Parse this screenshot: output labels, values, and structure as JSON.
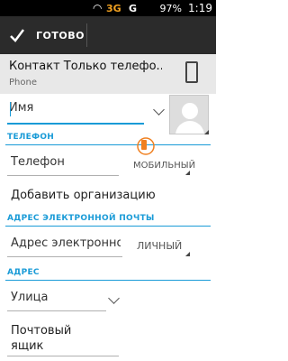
{
  "status_bar": {
    "network_1": "3G",
    "network_2": "G",
    "battery": "97%",
    "time": "1:19"
  },
  "action_bar": {
    "done_label": "ГОТОВО"
  },
  "account": {
    "title": "Контакт Только телефо...",
    "subtitle": "Phone"
  },
  "name": {
    "placeholder": "Имя"
  },
  "phone_section": {
    "header": "ТЕЛЕФОН",
    "field_placeholder": "Телефон",
    "type_label": "МОБИЛЬНЫЙ"
  },
  "add_org_label": "Добавить организацию",
  "email_section": {
    "header": "АДРЕС ЭЛЕКТРОННОЙ ПОЧТЫ",
    "field_placeholder": "Адрес электронно",
    "type_label": "ЛИЧНЫЙ"
  },
  "address_section": {
    "header": "АДРЕС",
    "street_placeholder": "Улица",
    "pobox_placeholder_line1": "Почтовый",
    "pobox_placeholder_line2": "ящик"
  },
  "colors": {
    "accent": "#1a9bd7",
    "action_bar": "#2b2b2b",
    "account_band": "#e8e8e8"
  }
}
